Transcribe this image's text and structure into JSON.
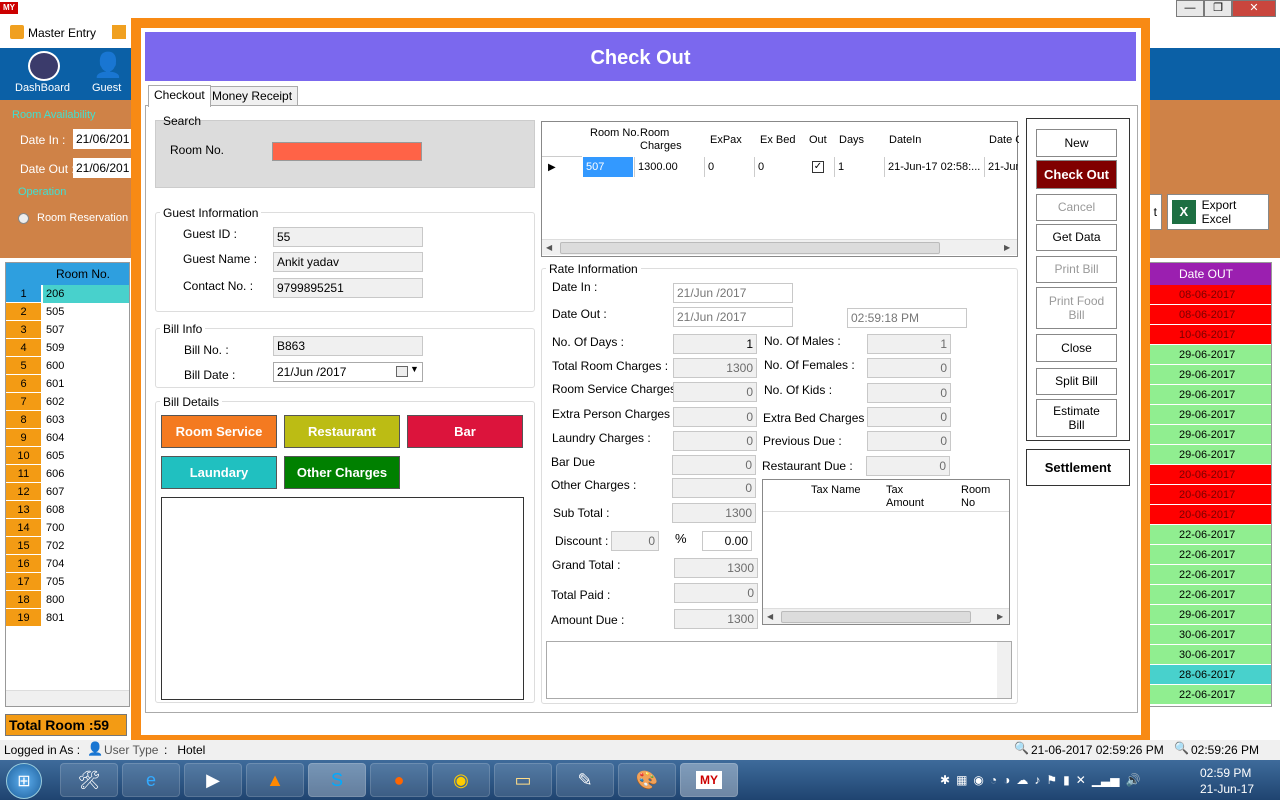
{
  "app": {
    "logo": "MY",
    "menu_master_entry": "Master Entry"
  },
  "sidebar": {
    "dashboard_label": "DashBoard",
    "guest_label": "Guest",
    "room_availability": "Room Availability",
    "date_in_label": "Date In :",
    "date_in_value": "21/06/201",
    "date_out_label": "Date Out :",
    "date_out_value": "21/06/201",
    "operation_label": "Operation",
    "room_reservation": "Room Reservation",
    "grid_header": "Room No.",
    "rooms": [
      {
        "n": "1",
        "room": "206"
      },
      {
        "n": "2",
        "room": "505"
      },
      {
        "n": "3",
        "room": "507"
      },
      {
        "n": "4",
        "room": "509"
      },
      {
        "n": "5",
        "room": "600"
      },
      {
        "n": "6",
        "room": "601"
      },
      {
        "n": "7",
        "room": "602"
      },
      {
        "n": "8",
        "room": "603"
      },
      {
        "n": "9",
        "room": "604"
      },
      {
        "n": "10",
        "room": "605"
      },
      {
        "n": "11",
        "room": "606"
      },
      {
        "n": "12",
        "room": "607"
      },
      {
        "n": "13",
        "room": "608"
      },
      {
        "n": "14",
        "room": "700"
      },
      {
        "n": "15",
        "room": "702"
      },
      {
        "n": "16",
        "room": "704"
      },
      {
        "n": "17",
        "room": "705"
      },
      {
        "n": "18",
        "room": "800"
      },
      {
        "n": "19",
        "room": "801"
      }
    ],
    "total_room": "Total Room :59"
  },
  "right_panel": {
    "export_excel": "Export Excel",
    "partial_button": "t",
    "date_out_header": "Date OUT",
    "dates": [
      {
        "d": "08-06-2017",
        "c": "#ff0000"
      },
      {
        "d": "08-06-2017",
        "c": "#ff0000"
      },
      {
        "d": "10-06-2017",
        "c": "#ff0000"
      },
      {
        "d": "29-06-2017",
        "c": "#90ee90"
      },
      {
        "d": "29-06-2017",
        "c": "#90ee90"
      },
      {
        "d": "29-06-2017",
        "c": "#90ee90"
      },
      {
        "d": "29-06-2017",
        "c": "#90ee90"
      },
      {
        "d": "29-06-2017",
        "c": "#90ee90"
      },
      {
        "d": "29-06-2017",
        "c": "#90ee90"
      },
      {
        "d": "20-06-2017",
        "c": "#ff0000"
      },
      {
        "d": "20-06-2017",
        "c": "#ff0000"
      },
      {
        "d": "20-06-2017",
        "c": "#ff0000"
      },
      {
        "d": "22-06-2017",
        "c": "#90ee90"
      },
      {
        "d": "22-06-2017",
        "c": "#90ee90"
      },
      {
        "d": "22-06-2017",
        "c": "#90ee90"
      },
      {
        "d": "22-06-2017",
        "c": "#90ee90"
      },
      {
        "d": "29-06-2017",
        "c": "#90ee90"
      },
      {
        "d": "30-06-2017",
        "c": "#90ee90"
      },
      {
        "d": "30-06-2017",
        "c": "#90ee90"
      },
      {
        "d": "28-06-2017",
        "c": "#48d1cc"
      },
      {
        "d": "22-06-2017",
        "c": "#90ee90"
      }
    ]
  },
  "checkout": {
    "title": "Check Out",
    "tabs": [
      "Checkout",
      "Money Receipt"
    ],
    "search": {
      "legend": "Search",
      "room_no_label": "Room No."
    },
    "guest_info": {
      "legend": "Guest Information",
      "guest_id_label": "Guest ID :",
      "guest_id": "55",
      "guest_name_label": "Guest Name :",
      "guest_name": "Ankit yadav",
      "contact_label": "Contact No. :",
      "contact": "9799895251"
    },
    "bill_info": {
      "legend": "Bill Info",
      "bill_no_label": "Bill No. :",
      "bill_no": "B863",
      "bill_date_label": "Bill Date :",
      "bill_date": "21/Jun /2017"
    },
    "bill_details": {
      "legend": "Bill Details",
      "room_service": "Room Service",
      "restaurant": "Restaurant",
      "bar": "Bar",
      "laundry": "Laundary",
      "other_charges": "Other Charges"
    },
    "room_grid": {
      "headers": [
        "Room No.",
        "Room Charges",
        "ExPax",
        "Ex Bed",
        "Out",
        "Days",
        "DateIn",
        "Date O"
      ],
      "row": {
        "room_no": "507",
        "room_charges": "1300.00",
        "expax": "0",
        "ex_bed": "0",
        "days": "1",
        "date_in": "21-Jun-17 02:58:...",
        "date_out": "21-Jun"
      }
    },
    "rate": {
      "legend": "Rate Information",
      "date_in_label": "Date In :",
      "date_in": "21/Jun /2017",
      "date_out_label": "Date Out :",
      "date_out": "21/Jun /2017",
      "time_out": "02:59:18 PM",
      "days_label": "No. Of Days :",
      "days": "1",
      "room_charges_label": "Total Room Charges :",
      "room_charges": "1300",
      "room_service_label": "Room Service Charges :",
      "room_service": "0",
      "extra_person_label": "Extra Person Charges :",
      "extra_person": "0",
      "laundry_label": "Laundry Charges :",
      "laundry": "0",
      "bar_due_label": "Bar Due",
      "bar_due": "0",
      "other_label": "Other Charges :",
      "other": "0",
      "sub_total_label": "Sub Total :",
      "sub_total": "1300",
      "discount_label": "Discount :",
      "discount": "0",
      "percent": "%",
      "discount_pct": "0.00",
      "grand_total_label": "Grand Total :",
      "grand_total": "1300",
      "total_paid_label": "Total Paid :",
      "total_paid": "0",
      "amount_due_label": "Amount Due :",
      "amount_due": "1300",
      "males_label": "No. Of Males :",
      "males": "1",
      "females_label": "No. Of Females :",
      "females": "0",
      "kids_label": "No. Of Kids :",
      "kids": "0",
      "extra_bed_label": "Extra Bed Charges :",
      "extra_bed": "0",
      "prev_due_label": "Previous Due :",
      "prev_due": "0",
      "rest_due_label": "Restaurant Due :",
      "rest_due": "0",
      "tax_headers": [
        "Tax Name",
        "Tax Amount",
        "Room No"
      ]
    },
    "actions": {
      "new": "New",
      "check_out": "Check Out",
      "cancel": "Cancel",
      "get_data": "Get Data",
      "print_bill": "Print Bill",
      "print_food_bill": "Print Food Bill",
      "close": "Close",
      "split_bill": "Split Bill",
      "estimate_bill": "Estimate Bill",
      "settlement": "Settlement"
    }
  },
  "status_bar": {
    "logged_in": "Logged in As :",
    "user_type": "User Type",
    "user_value": ":   Hotel",
    "datetime": "21-06-2017 02:59:26 PM",
    "time": "02:59:26 PM"
  },
  "taskbar": {
    "clock_time": "02:59 PM",
    "clock_date": "21-Jun-17",
    "my_hotel": "MY"
  }
}
